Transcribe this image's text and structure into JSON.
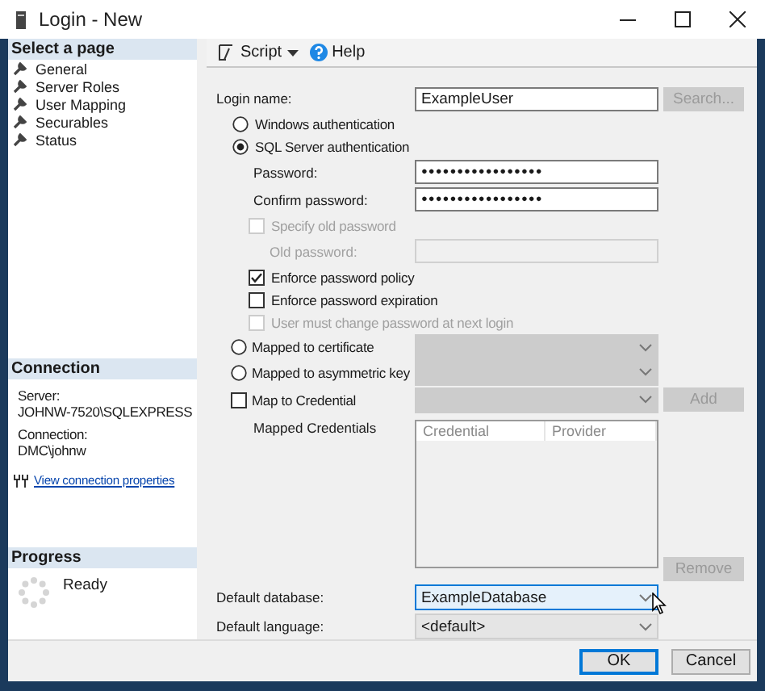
{
  "window": {
    "title": "Login - New"
  },
  "sidebar": {
    "header": "Select a page",
    "items": [
      {
        "label": "General",
        "selected": false
      },
      {
        "label": "Server Roles",
        "selected": false
      },
      {
        "label": "User Mapping",
        "selected": false
      },
      {
        "label": "Securables",
        "selected": false
      },
      {
        "label": "Status",
        "selected": false
      }
    ]
  },
  "connection": {
    "header": "Connection",
    "server_label": "Server:",
    "server": "JOHNW-7520\\SQLEXPRESS",
    "connection_label": "Connection:",
    "connection": "DMC\\johnw",
    "link": "View connection properties"
  },
  "progress": {
    "header": "Progress",
    "status": "Ready"
  },
  "toolbar": [
    {
      "kind": "dropdown",
      "label": "Script"
    },
    {
      "kind": "help",
      "label": "Help"
    }
  ],
  "login_name": {
    "label": "Login name:",
    "value": "ExampleUser"
  },
  "search_button": {
    "label": "Search...",
    "disabled": true
  },
  "auth_options": [
    {
      "label": "Windows authentication",
      "selected": false
    },
    {
      "label": "SQL Server authentication",
      "selected": true
    }
  ],
  "password": {
    "label": "Password:",
    "value": "●●●●●●●●●●●●●●●●●"
  },
  "confirm_password": {
    "label": "Confirm password:",
    "value": "●●●●●●●●●●●●●●●●●"
  },
  "specify_old_password": {
    "label": "Specify old password",
    "checked": false,
    "disabled": true
  },
  "old_password": {
    "label": "Old password:",
    "disabled": true
  },
  "policy_options": [
    {
      "label": "Enforce password policy",
      "checked": true,
      "disabled": false
    },
    {
      "label": "Enforce password expiration",
      "checked": false,
      "disabled": false
    },
    {
      "label": "User must change password at next login",
      "checked": false,
      "disabled": true
    }
  ],
  "mappings": [
    {
      "kind": "radio",
      "label": "Mapped to certificate",
      "selected": false
    },
    {
      "kind": "radio",
      "label": "Mapped to asymmetric key",
      "selected": false
    },
    {
      "kind": "checkbox",
      "label": "Map to Credential",
      "checked": false
    }
  ],
  "add_button": {
    "label": "Add",
    "disabled": true
  },
  "mapped_credentials": {
    "label": "Mapped Credentials",
    "columns": [
      "Credential",
      "Provider"
    ]
  },
  "remove_button": {
    "label": "Remove",
    "disabled": true
  },
  "defaults": [
    {
      "label": "Default database:",
      "value": "ExampleDatabase",
      "focused": true
    },
    {
      "label": "Default language:",
      "value": "<default>",
      "focused": false
    }
  ],
  "buttons": [
    {
      "label": "OK",
      "default": true
    },
    {
      "label": "Cancel",
      "default": false
    }
  ]
}
